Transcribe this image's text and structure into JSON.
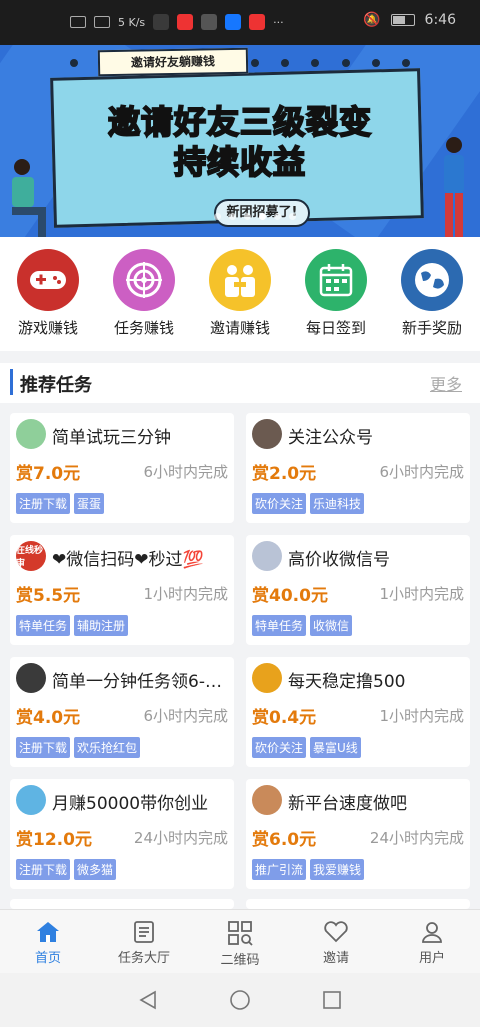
{
  "status_bar": {
    "time": "6:46",
    "speed": "5 K/s"
  },
  "banner": {
    "note": "邀请好友躺赚钱",
    "line1": "邀请好友三级裂变",
    "line2": "持续收益",
    "tag": "新团招募了!"
  },
  "categories": [
    {
      "label": "游戏赚钱",
      "icon": "gamepad-icon",
      "color": "#c9302c"
    },
    {
      "label": "任务赚钱",
      "icon": "target-icon",
      "color": "#cc5fc3"
    },
    {
      "label": "邀请赚钱",
      "icon": "handshake-icon",
      "color": "#f5c22a"
    },
    {
      "label": "每日签到",
      "icon": "calendar-icon",
      "color": "#2db36b"
    },
    {
      "label": "新手奖励",
      "icon": "globe-icon",
      "color": "#2c6ab1"
    }
  ],
  "section": {
    "title": "推荐任务",
    "more": "更多"
  },
  "tasks": [
    {
      "title": "简单试玩三分钟",
      "reward": "赏7.0元",
      "time": "6小时内完成",
      "tags": [
        "注册下载",
        "蛋蛋"
      ],
      "avatar_color": "#8fcf9a",
      "avatar_text": ""
    },
    {
      "title": "关注公众号",
      "reward": "赏2.0元",
      "time": "6小时内完成",
      "tags": [
        "砍价关注",
        "乐迪科技"
      ],
      "avatar_color": "#6b5a50",
      "avatar_text": ""
    },
    {
      "title": "❤微信扫码❤秒过💯",
      "reward": "赏5.5元",
      "time": "1小时内完成",
      "tags": [
        "特单任务",
        "辅助注册"
      ],
      "avatar_color": "#d43a2a",
      "avatar_text": "在线秒审"
    },
    {
      "title": "高价收微信号",
      "reward": "赏40.0元",
      "time": "1小时内完成",
      "tags": [
        "特单任务",
        "收微信"
      ],
      "avatar_color": "#b9c3d6",
      "avatar_text": ""
    },
    {
      "title": "简单一分钟任务领6-…",
      "reward": "赏4.0元",
      "time": "6小时内完成",
      "tags": [
        "注册下载",
        "欢乐抢红包"
      ],
      "avatar_color": "#3a3a3a",
      "avatar_text": ""
    },
    {
      "title": "每天稳定撸500",
      "reward": "赏0.4元",
      "time": "1小时内完成",
      "tags": [
        "砍价关注",
        "暴富U线"
      ],
      "avatar_color": "#e8a21c",
      "avatar_text": ""
    },
    {
      "title": "月赚50000带你创业",
      "reward": "赏12.0元",
      "time": "24小时内完成",
      "tags": [
        "注册下载",
        "微多猫"
      ],
      "avatar_color": "#5fb4e3",
      "avatar_text": ""
    },
    {
      "title": "新平台速度做吧",
      "reward": "赏6.0元",
      "time": "24小时内完成",
      "tags": [
        "推广引流",
        "我爱赚钱"
      ],
      "avatar_color": "#c98a5a",
      "avatar_text": ""
    }
  ],
  "bottom_nav": [
    {
      "label": "首页",
      "icon": "home-icon",
      "active": true
    },
    {
      "label": "任务大厅",
      "icon": "list-icon",
      "active": false
    },
    {
      "label": "二维码",
      "icon": "qrcode-icon",
      "active": false
    },
    {
      "label": "邀请",
      "icon": "heart-icon",
      "active": false
    },
    {
      "label": "用户",
      "icon": "user-icon",
      "active": false
    }
  ],
  "colors": {
    "accent": "#2f6fd6",
    "reward": "#e37a0c",
    "tag": "#7f9de9",
    "nav_active": "#2f80e0"
  }
}
